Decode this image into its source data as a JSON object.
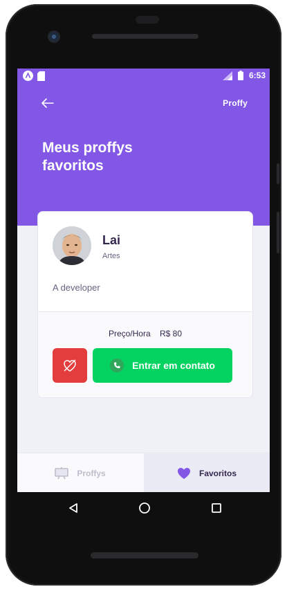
{
  "status_bar": {
    "time": "6:53",
    "icons": [
      "app-icon",
      "sd-card-icon",
      "lte-signal-icon",
      "battery-icon"
    ]
  },
  "header": {
    "brand": "Proffy",
    "title_line1": "Meus proffys",
    "title_line2": "favoritos",
    "background": "#8257e5"
  },
  "teacher": {
    "name": "Lai",
    "subject": "Artes",
    "bio": "A developer",
    "price_label": "Preço/Hora",
    "price_value": "R$ 80"
  },
  "actions": {
    "unfavorite_color": "#e33d3d",
    "contact_label": "Entrar em contato",
    "contact_color": "#04d361"
  },
  "tabs": [
    {
      "label": "Proffys",
      "icon": "easel-icon",
      "active": false
    },
    {
      "label": "Favoritos",
      "icon": "heart-icon",
      "active": true
    }
  ],
  "nav": [
    "back-triangle-icon",
    "home-circle-icon",
    "recents-square-icon"
  ]
}
